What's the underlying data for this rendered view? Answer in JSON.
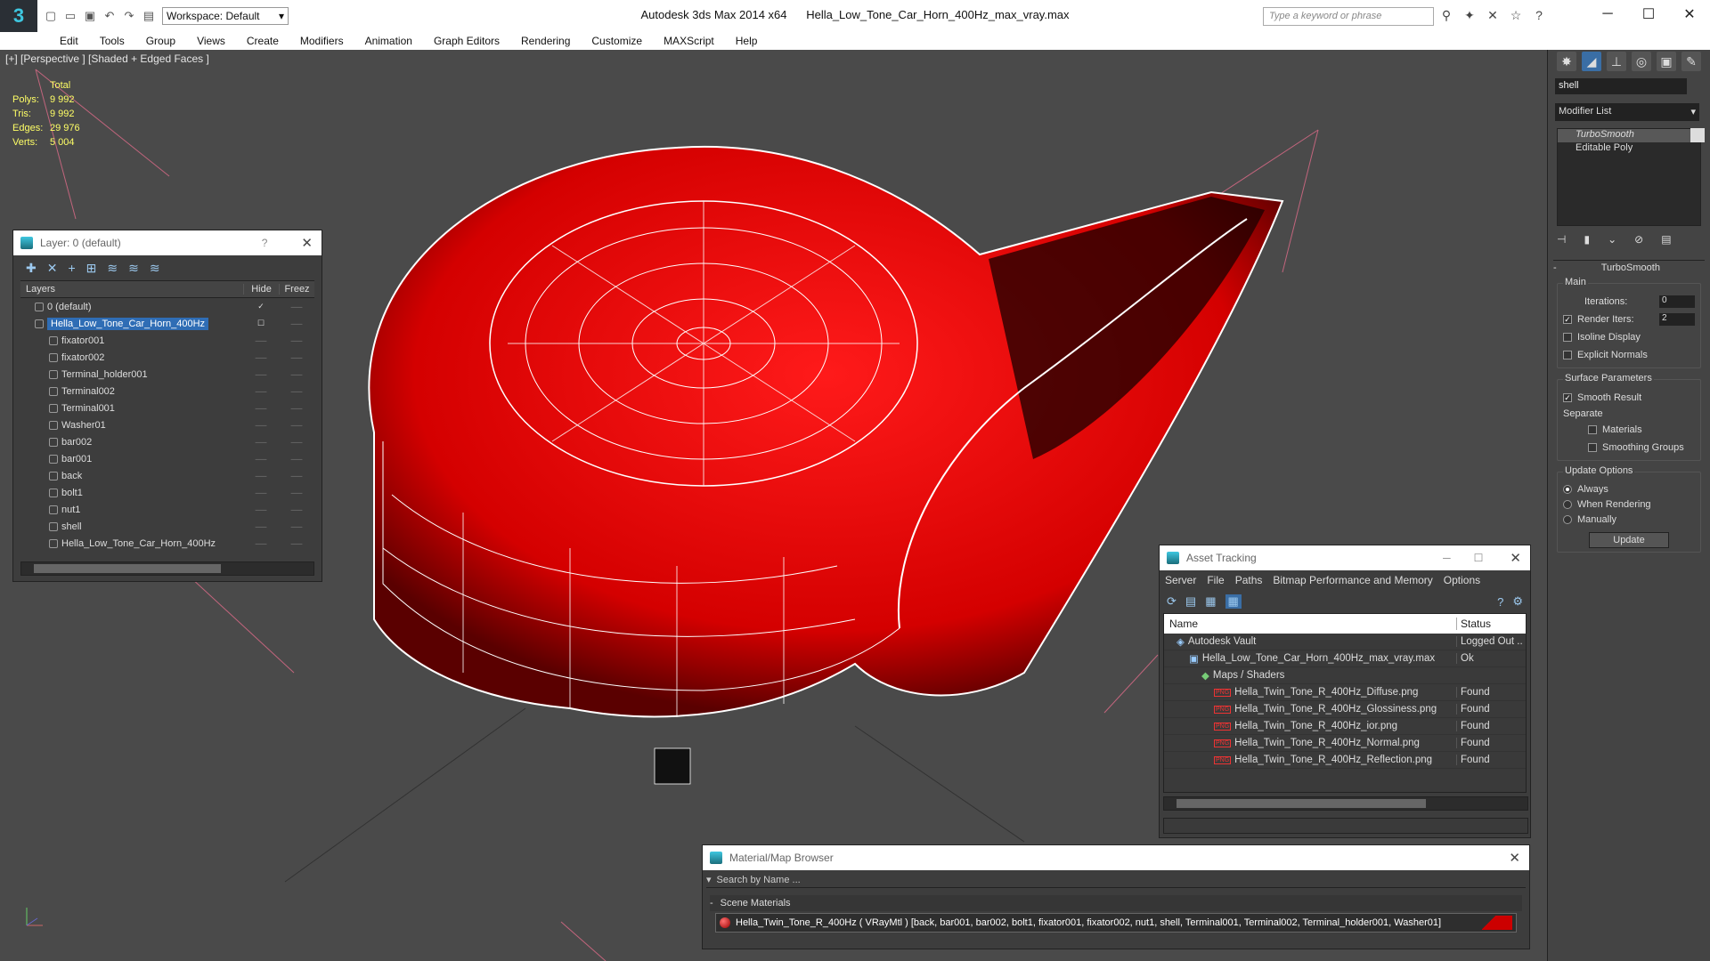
{
  "app": {
    "title": "Autodesk 3ds Max  2014 x64",
    "file": "Hella_Low_Tone_Car_Horn_400Hz_max_vray.max",
    "workspace": "Workspace: Default",
    "search_placeholder": "Type a keyword or phrase",
    "logo": "3"
  },
  "menu": [
    "Edit",
    "Tools",
    "Group",
    "Views",
    "Create",
    "Modifiers",
    "Animation",
    "Graph Editors",
    "Rendering",
    "Customize",
    "MAXScript",
    "Help"
  ],
  "viewport": {
    "label": "[+] [Perspective ] [Shaded + Edged Faces ]",
    "stats_header": "Total",
    "stats": [
      {
        "label": "Polys:",
        "value": "9 992"
      },
      {
        "label": "Tris:",
        "value": "9 992"
      },
      {
        "label": "Edges:",
        "value": "29 976"
      },
      {
        "label": "Verts:",
        "value": "5 004"
      }
    ]
  },
  "layer_panel": {
    "title": "Layer: 0 (default)",
    "help": "?",
    "cols": {
      "layers": "Layers",
      "hide": "Hide",
      "freeze": "Freez"
    },
    "rows": [
      {
        "name": "0 (default)",
        "indent": 1
      },
      {
        "name": "Hella_Low_Tone_Car_Horn_400Hz",
        "indent": 1,
        "selected": true
      },
      {
        "name": "fixator001",
        "indent": 2
      },
      {
        "name": "fixator002",
        "indent": 2
      },
      {
        "name": "Terminal_holder001",
        "indent": 2
      },
      {
        "name": "Terminal002",
        "indent": 2
      },
      {
        "name": "Terminal001",
        "indent": 2
      },
      {
        "name": "Washer01",
        "indent": 2
      },
      {
        "name": "bar002",
        "indent": 2
      },
      {
        "name": "bar001",
        "indent": 2
      },
      {
        "name": "back",
        "indent": 2
      },
      {
        "name": "bolt1",
        "indent": 2
      },
      {
        "name": "nut1",
        "indent": 2
      },
      {
        "name": "shell",
        "indent": 2
      },
      {
        "name": "Hella_Low_Tone_Car_Horn_400Hz",
        "indent": 2
      }
    ]
  },
  "asset_panel": {
    "title": "Asset Tracking",
    "menu": [
      "Server",
      "File",
      "Paths",
      "Bitmap Performance and Memory",
      "Options"
    ],
    "cols": {
      "name": "Name",
      "status": "Status"
    },
    "rows": [
      {
        "name": "Autodesk Vault",
        "status": "Logged Out ..",
        "indent": 1
      },
      {
        "name": "Hella_Low_Tone_Car_Horn_400Hz_max_vray.max",
        "status": "Ok",
        "indent": 2
      },
      {
        "name": "Maps / Shaders",
        "status": "",
        "indent": 3
      },
      {
        "name": "Hella_Twin_Tone_R_400Hz_Diffuse.png",
        "status": "Found",
        "indent": 4,
        "png": true
      },
      {
        "name": "Hella_Twin_Tone_R_400Hz_Glossiness.png",
        "status": "Found",
        "indent": 4,
        "png": true
      },
      {
        "name": "Hella_Twin_Tone_R_400Hz_ior.png",
        "status": "Found",
        "indent": 4,
        "png": true
      },
      {
        "name": "Hella_Twin_Tone_R_400Hz_Normal.png",
        "status": "Found",
        "indent": 4,
        "png": true
      },
      {
        "name": "Hella_Twin_Tone_R_400Hz_Reflection.png",
        "status": "Found",
        "indent": 4,
        "png": true
      }
    ],
    "png_tag": "PNG"
  },
  "material_panel": {
    "title": "Material/Map Browser",
    "search": "Search by Name ...",
    "section": "Scene Materials",
    "material": "Hella_Twin_Tone_R_400Hz  ( VRayMtl )  [back, bar001, bar002, bolt1, fixator001, fixator002, nut1, shell, Terminal001, Terminal002, Terminal_holder001, Washer01]"
  },
  "command_panel": {
    "object_name": "shell",
    "modifier_list": "Modifier List",
    "stack": [
      "TurboSmooth",
      "Editable Poly"
    ],
    "rollout_title": "TurboSmooth",
    "main_group": "Main",
    "iterations_label": "Iterations:",
    "iterations": "0",
    "render_iters_label": "Render Iters:",
    "render_iters": "2",
    "isoline": "Isoline Display",
    "explicit_normals": "Explicit Normals",
    "surface_group": "Surface Parameters",
    "smooth_result": "Smooth Result",
    "separate": "Separate",
    "materials": "Materials",
    "smoothing_groups": "Smoothing Groups",
    "update_group": "Update Options",
    "always": "Always",
    "when_rendering": "When Rendering",
    "manually": "Manually",
    "update_btn": "Update"
  },
  "colors": {
    "accent": "#3ec7e0",
    "model": "#e00000",
    "selection": "#2f6db5",
    "stats": "#ffff66"
  }
}
